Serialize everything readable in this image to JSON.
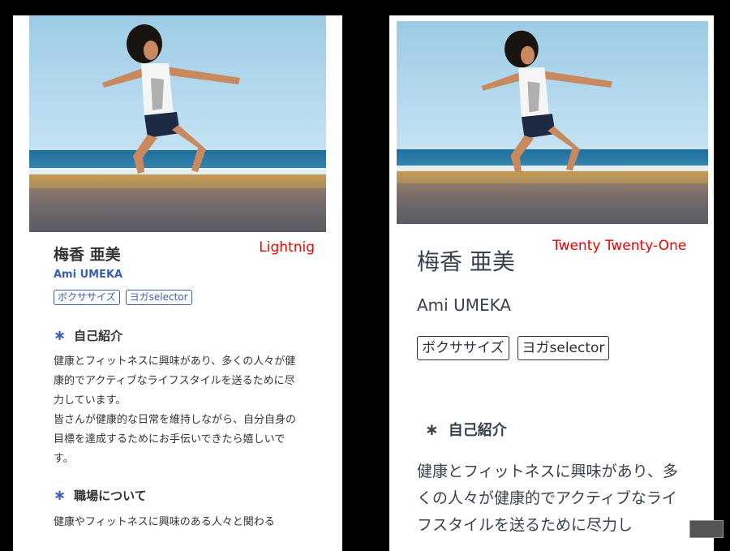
{
  "profile": {
    "name_jp": "梅香 亜美",
    "name_en": "Ami UMEKA",
    "tags": [
      "ボクササイズ",
      "ヨガselector"
    ]
  },
  "lightning": {
    "theme_label": "Lightnig",
    "sections": [
      {
        "heading": "自己紹介",
        "paragraphs": [
          "健康とフィットネスに興味があり、多くの人々が健康的でアクティブなライフスタイルを送るために尽力しています。",
          "皆さんが健康的な日常を維持しながら、自分自身の目標を達成するためにお手伝いできたら嬉しいです。"
        ]
      },
      {
        "heading": "職場について",
        "paragraphs": [
          "健康やフィットネスに興味のある人々と関わる"
        ]
      }
    ]
  },
  "twentyone": {
    "theme_label": "Twenty Twenty-One",
    "section": {
      "heading": "自己紹介",
      "paragraph": "健康とフィットネスに興味があり、多くの人々が健康的でアクティブなライフスタイルを送るために尽力し"
    }
  },
  "colors": {
    "lightning_accent": "#3a5fb0",
    "label_red": "#e00000",
    "twentyone_text": "#39414d"
  },
  "icons": {
    "section_marker": "asterisk-icon"
  }
}
